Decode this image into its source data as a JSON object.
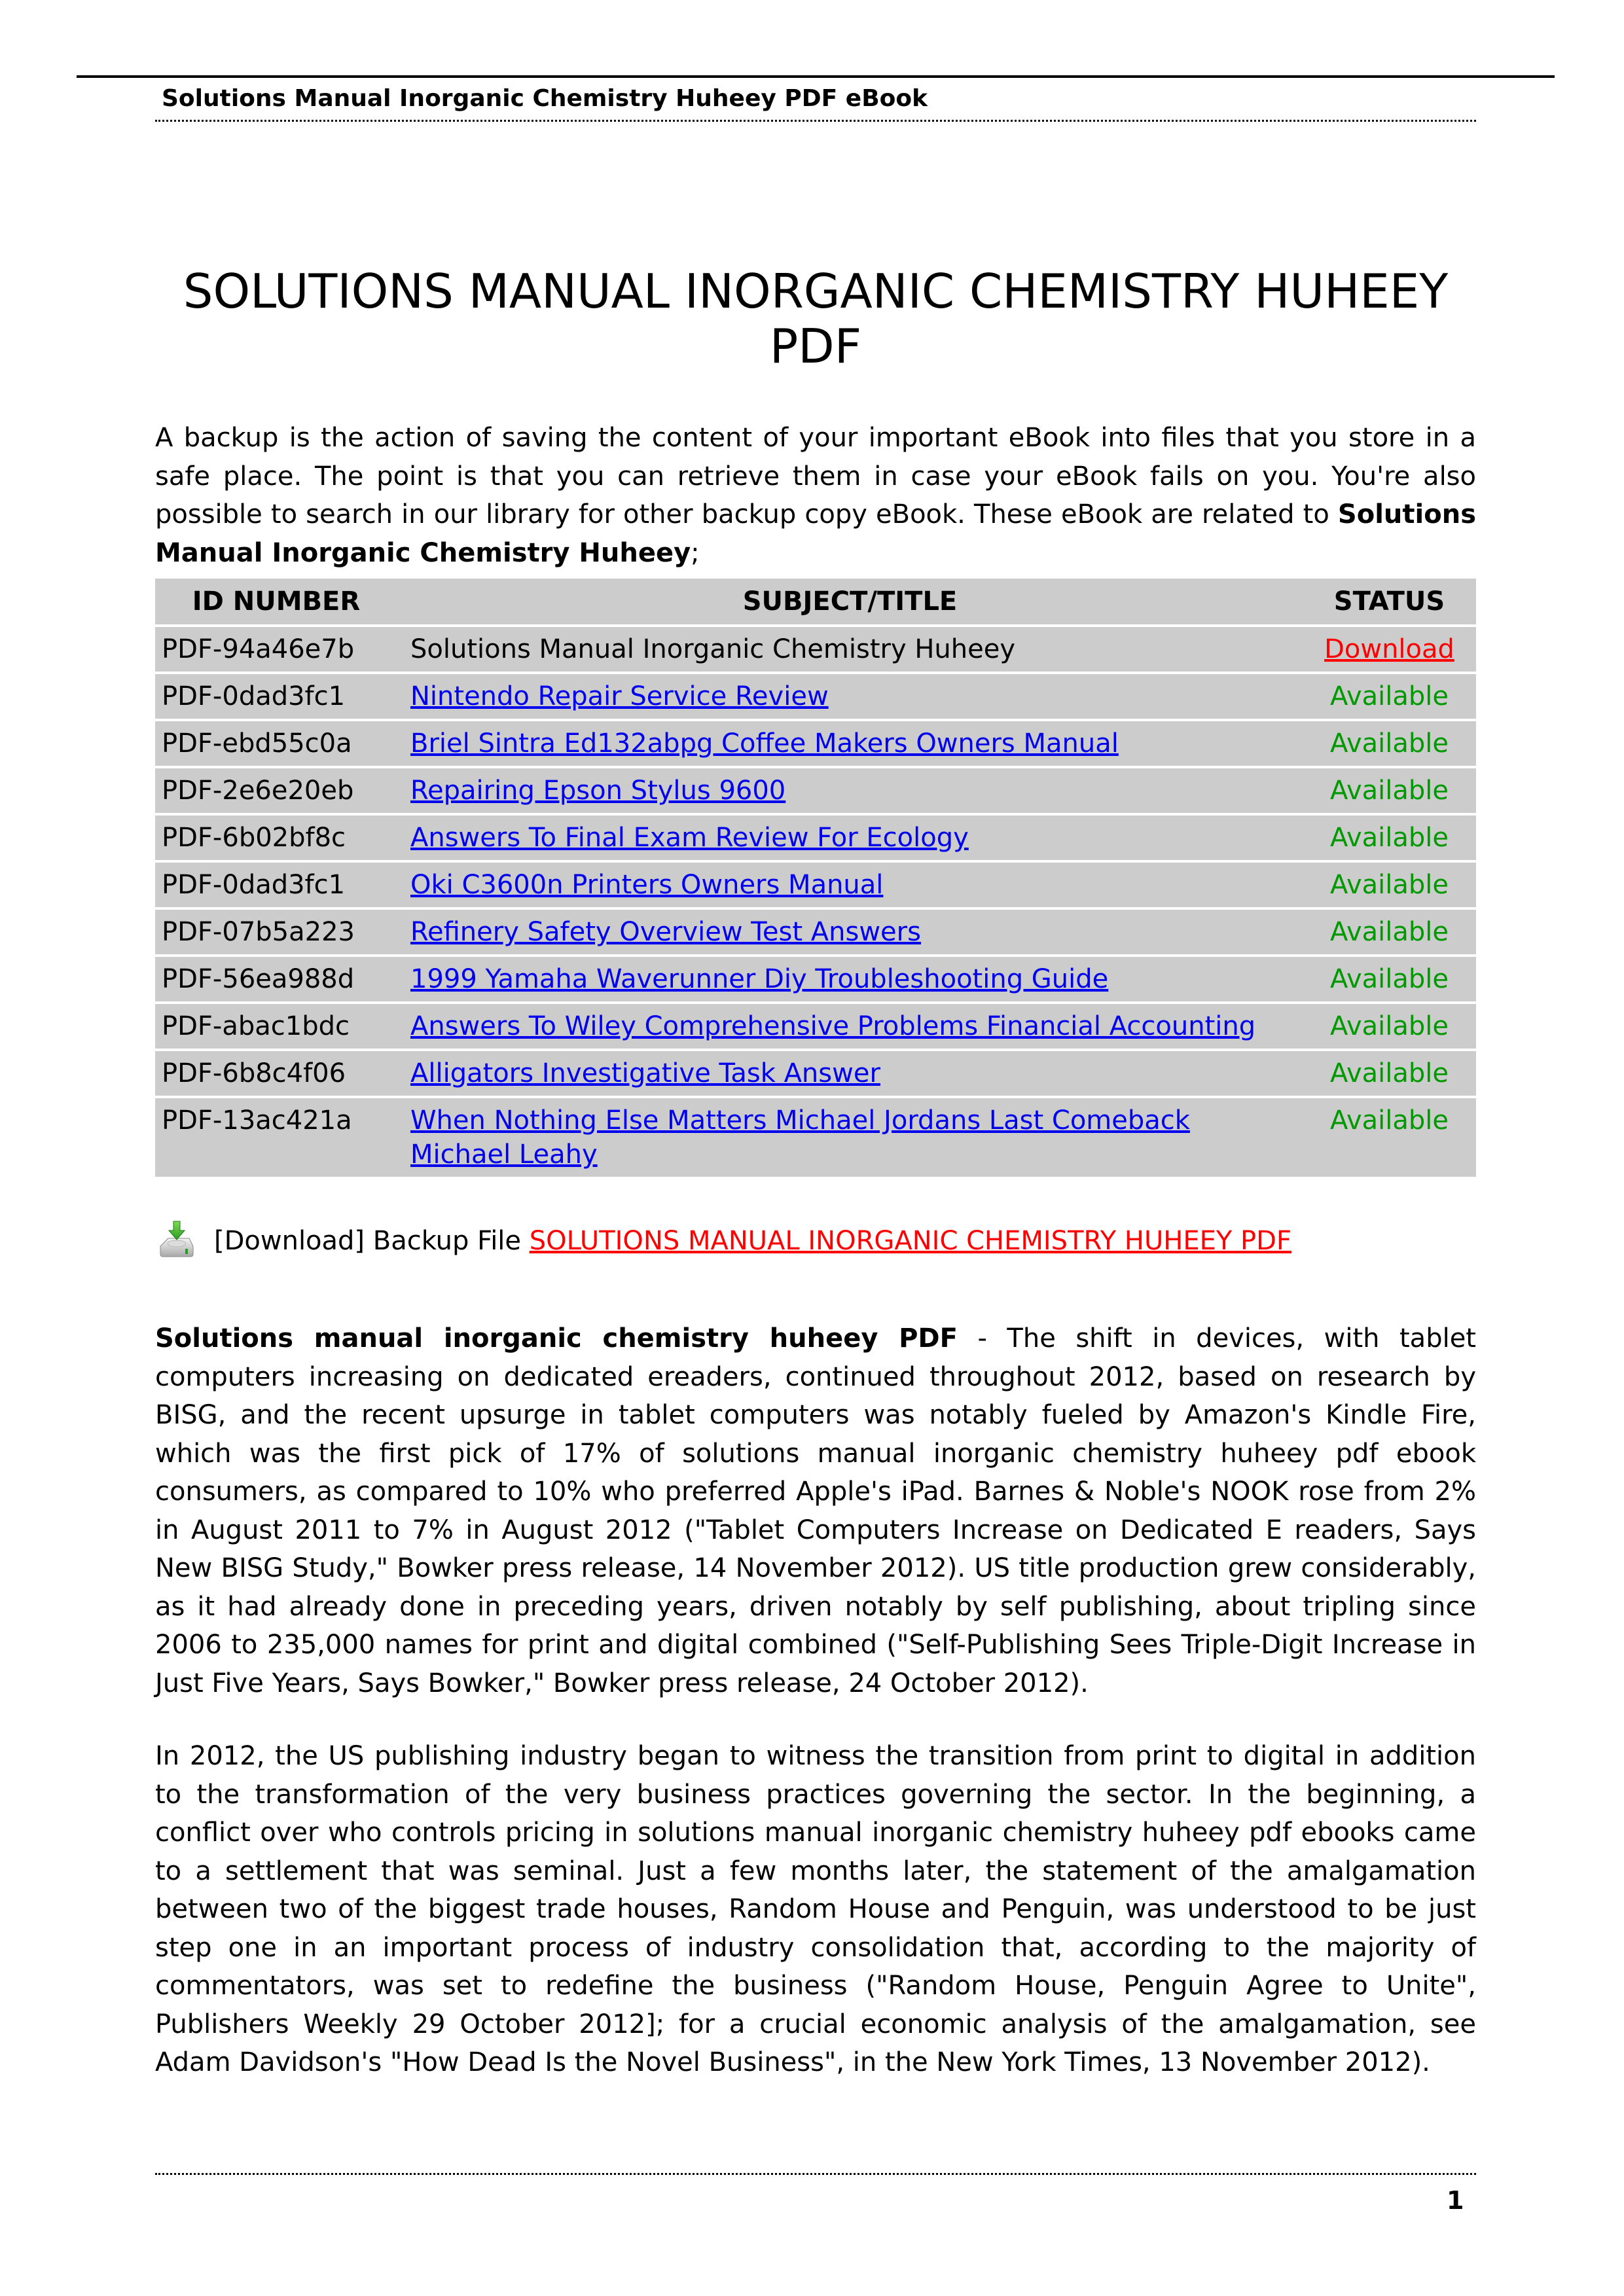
{
  "header": {
    "running_title": "Solutions Manual Inorganic Chemistry Huheey PDF eBook"
  },
  "title": "SOLUTIONS MANUAL INORGANIC CHEMISTRY HUHEEY PDF",
  "intro": {
    "text": "A backup is the action of saving the content of your important eBook into files that you store in a safe place. The point is that you can retrieve them in case your eBook fails on you. You're also possible to search in our library for other backup copy eBook. These eBook are related to ",
    "bold": "Solutions Manual Inorganic Chemistry Huheey",
    "suffix": ";"
  },
  "table": {
    "headers": [
      "ID NUMBER",
      "SUBJECT/TITLE",
      "STATUS"
    ],
    "rows": [
      {
        "id": "PDF-94a46e7b",
        "title": "Solutions Manual Inorganic Chemistry Huheey",
        "status": "Download"
      },
      {
        "id": "PDF-0dad3fc1",
        "title": "Nintendo Repair Service Review",
        "status": "Available"
      },
      {
        "id": "PDF-ebd55c0a",
        "title": "Briel Sintra Ed132abpg Coffee Makers Owners Manual",
        "status": "Available"
      },
      {
        "id": "PDF-2e6e20eb",
        "title": "Repairing Epson Stylus 9600",
        "status": "Available"
      },
      {
        "id": "PDF-6b02bf8c",
        "title": "Answers To Final Exam Review For Ecology",
        "status": "Available"
      },
      {
        "id": "PDF-0dad3fc1",
        "title": "Oki C3600n Printers Owners Manual",
        "status": "Available"
      },
      {
        "id": "PDF-07b5a223",
        "title": "Refinery Safety Overview Test Answers",
        "status": "Available"
      },
      {
        "id": "PDF-56ea988d",
        "title": "1999 Yamaha Waverunner Diy Troubleshooting Guide",
        "status": "Available"
      },
      {
        "id": "PDF-abac1bdc",
        "title": "Answers To Wiley Comprehensive Problems Financial Accounting",
        "status": "Available"
      },
      {
        "id": "PDF-6b8c4f06",
        "title": "Alligators Investigative Task Answer",
        "status": "Available"
      },
      {
        "id": "PDF-13ac421a",
        "title": "When Nothing Else Matters Michael Jordans Last Comeback Michael Leahy",
        "status": "Available"
      }
    ]
  },
  "backup": {
    "icon": "download-drive-icon",
    "prefix": "[Download] Backup File ",
    "link": "SOLUTIONS MANUAL INORGANIC CHEMISTRY HUHEEY PDF"
  },
  "body": {
    "p1_bold": "Solutions manual inorganic chemistry huheey PDF",
    "p1_text": " - The shift in devices, with tablet computers increasing on dedicated ereaders, continued throughout 2012, based on research by BISG, and the recent upsurge in tablet computers was notably fueled by Amazon's Kindle Fire, which was the first pick of 17% of solutions manual inorganic chemistry huheey pdf ebook consumers, as compared to 10% who preferred Apple's iPad. Barnes & Noble's NOOK rose from 2% in August 2011 to 7% in August 2012 (\"Tablet Computers Increase on Dedicated E readers, Says New BISG Study,\" Bowker press release, 14 November 2012). US title production grew considerably, as it had already done in preceding years, driven notably by self publishing, about tripling since 2006 to 235,000 names for print and digital combined (\"Self-Publishing Sees Triple-Digit Increase in Just Five Years, Says Bowker,\" Bowker press release, 24 October 2012).",
    "p2_text": "In 2012, the US publishing industry began to witness the transition from print to digital in addition to the transformation of the very business practices governing the sector. In the beginning, a conflict over who controls pricing in solutions manual inorganic chemistry huheey pdf ebooks came to a settlement that was seminal. Just a few months later, the statement of the amalgamation between two of the biggest trade houses, Random House and Penguin, was understood to be just step one in an important process of industry consolidation that, according to the majority of commentators, was set to redefine the business (\"Random House, Penguin Agree to Unite\", Publishers Weekly 29 October 2012]; for a crucial economic analysis of the amalgamation, see Adam Davidson's \"How Dead Is the Novel Business\", in the New York Times, 13 November 2012)."
  },
  "footer": {
    "page_number": "1"
  },
  "colors": {
    "link_blue": "#0000ee",
    "download_red": "#ff0000",
    "available_green": "#009900",
    "table_bg": "#cccccc"
  }
}
